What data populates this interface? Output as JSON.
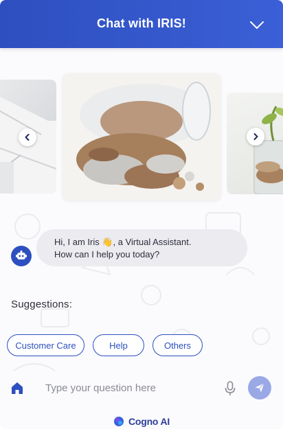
{
  "header": {
    "title": "Chat with IRIS!",
    "collapse_icon": "chevron-down-icon"
  },
  "carousel": {
    "prev_icon": "chevron-left-icon",
    "next_icon": "chevron-right-icon",
    "slides": [
      {
        "image": "papers-image"
      },
      {
        "image": "coins-jar-image"
      },
      {
        "image": "plant-coins-image"
      }
    ]
  },
  "message": {
    "avatar_icon": "bot-icon",
    "line1": "Hi, I am Iris 👋, a Virtual Assistant.",
    "line2": "How can I help you today?"
  },
  "suggestions": {
    "label": "Suggestions:",
    "chips": [
      "Customer Care",
      "Help",
      "Others"
    ]
  },
  "composer": {
    "placeholder": "Type your question here",
    "value": "",
    "home_icon": "home-icon",
    "mic_icon": "mic-icon",
    "send_icon": "send-icon"
  },
  "footer": {
    "brand": "Cogno AI",
    "logo_icon": "cogno-logo-icon"
  },
  "colors": {
    "primary": "#2d4fbf",
    "bubble": "#ebebf0",
    "send_disabled": "#9aa8e6"
  }
}
